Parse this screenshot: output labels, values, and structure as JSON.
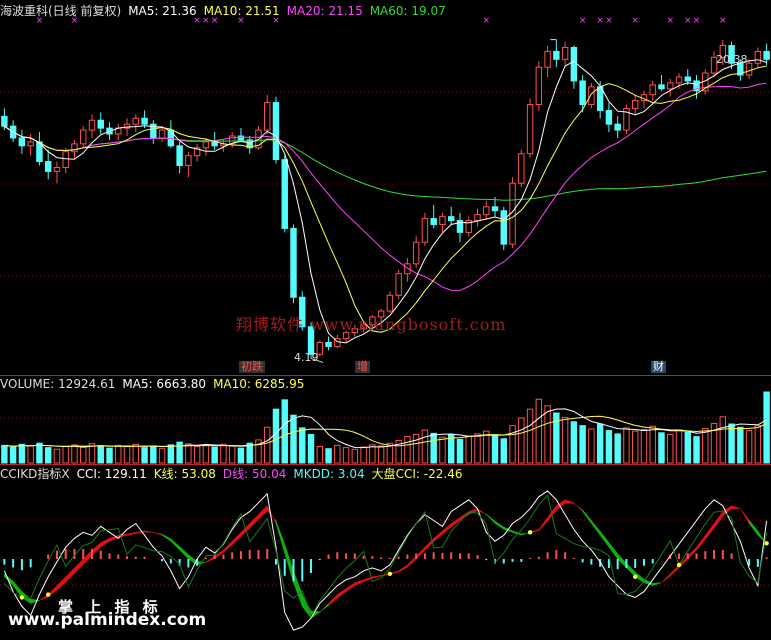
{
  "price_header": {
    "title": "海波重科(日线 前复权)",
    "ma5": "MA5: 21.36",
    "ma10": "MA10: 21.51",
    "ma20": "MA20: 21.15",
    "ma60": "MA60: 19.07"
  },
  "volume_header": {
    "title": "VOLUME: 12924.61",
    "ma5": "MA5: 6663.80",
    "ma10": "MA10: 6285.95"
  },
  "cci_header": {
    "title": "CCIKD指标X",
    "cci": "CCI: 129.11",
    "k": "K线: 53.08",
    "d": "D线: 50.04",
    "mkdd": "MKDD: 3.04",
    "dapan": "大盘CCI: -22.46"
  },
  "annotations": {
    "high_label": "20.38",
    "low_label": "4.19",
    "event_1": "初跌",
    "event_2": "增",
    "event_3": "财",
    "marker_glyph": "×"
  },
  "watermarks": {
    "top": "翔博软件 www.xiangbosoft.com",
    "bottom_cn": "掌 上 指 标",
    "bottom_url": "www.palmindex.com"
  },
  "colors": {
    "up": "#ff5050",
    "down": "#54fcfc",
    "ma5": "#ffffff",
    "ma10": "#ffff55",
    "ma20": "#ff44ff",
    "ma60": "#33dd33",
    "grid": "#8a1010"
  },
  "chart_data": [
    {
      "type": "candlestick",
      "title": "海波重科(日线 前复权)",
      "ylim": [
        3.5,
        21.5
      ],
      "labels": {
        "high": "20.38",
        "low": "4.19"
      },
      "series": [
        {
          "name": "MA5",
          "last": 21.36
        },
        {
          "name": "MA10",
          "last": 21.51
        },
        {
          "name": "MA20",
          "last": 21.15
        },
        {
          "name": "MA60",
          "last": 19.07
        }
      ],
      "ohlc": [
        [
          16.5,
          16.9,
          15.8,
          16.0
        ],
        [
          16.0,
          16.3,
          15.2,
          15.4
        ],
        [
          15.4,
          15.8,
          14.6,
          15.0
        ],
        [
          15.0,
          15.6,
          14.5,
          15.2
        ],
        [
          15.2,
          15.7,
          14.0,
          14.2
        ],
        [
          14.2,
          14.8,
          13.3,
          13.7
        ],
        [
          13.7,
          14.2,
          13.1,
          13.9
        ],
        [
          13.9,
          14.9,
          13.6,
          14.7
        ],
        [
          14.7,
          15.3,
          14.3,
          15.1
        ],
        [
          15.1,
          16.0,
          14.9,
          15.8
        ],
        [
          15.8,
          16.6,
          15.4,
          16.3
        ],
        [
          16.3,
          16.7,
          15.6,
          15.9
        ],
        [
          15.9,
          16.2,
          15.3,
          15.6
        ],
        [
          15.6,
          16.1,
          15.3,
          15.9
        ],
        [
          15.9,
          16.4,
          15.5,
          16.1
        ],
        [
          16.1,
          16.6,
          15.7,
          16.4
        ],
        [
          16.4,
          16.8,
          15.9,
          16.1
        ],
        [
          16.1,
          16.3,
          15.1,
          15.4
        ],
        [
          15.4,
          16.0,
          15.2,
          15.8
        ],
        [
          15.8,
          16.3,
          14.9,
          15.0
        ],
        [
          15.0,
          15.2,
          13.6,
          14.0
        ],
        [
          14.0,
          14.7,
          13.4,
          14.5
        ],
        [
          14.5,
          15.1,
          14.2,
          14.9
        ],
        [
          14.9,
          15.4,
          14.5,
          15.2
        ],
        [
          15.2,
          15.7,
          14.8,
          15.0
        ],
        [
          15.0,
          15.3,
          14.7,
          15.1
        ],
        [
          15.1,
          15.7,
          14.9,
          15.5
        ],
        [
          15.5,
          15.9,
          15.2,
          15.3
        ],
        [
          15.3,
          15.5,
          14.6,
          14.9
        ],
        [
          14.9,
          16.0,
          14.8,
          15.8
        ],
        [
          15.8,
          17.6,
          15.6,
          17.2
        ],
        [
          17.2,
          17.5,
          14.1,
          14.3
        ],
        [
          14.3,
          14.5,
          10.6,
          10.8
        ],
        [
          10.8,
          11.0,
          7.0,
          7.3
        ],
        [
          7.3,
          7.6,
          5.6,
          5.8
        ],
        [
          5.8,
          6.0,
          4.19,
          4.4
        ],
        [
          4.4,
          5.1,
          4.3,
          5.0
        ],
        [
          5.0,
          5.3,
          4.6,
          4.8
        ],
        [
          4.8,
          5.4,
          4.7,
          5.2
        ],
        [
          5.2,
          5.6,
          5.0,
          5.5
        ],
        [
          5.5,
          5.9,
          5.3,
          5.7
        ],
        [
          5.7,
          6.1,
          5.5,
          5.9
        ],
        [
          5.9,
          6.4,
          5.8,
          6.3
        ],
        [
          6.3,
          6.7,
          6.0,
          6.6
        ],
        [
          6.6,
          7.6,
          6.5,
          7.4
        ],
        [
          7.4,
          8.7,
          7.2,
          8.5
        ],
        [
          8.5,
          9.3,
          8.1,
          9.0
        ],
        [
          9.0,
          10.4,
          8.8,
          10.1
        ],
        [
          10.1,
          11.6,
          9.9,
          11.3
        ],
        [
          11.3,
          12.0,
          10.8,
          11.0
        ],
        [
          11.0,
          11.6,
          10.6,
          11.4
        ],
        [
          11.4,
          11.9,
          11.0,
          11.2
        ],
        [
          11.2,
          11.6,
          10.1,
          10.6
        ],
        [
          10.6,
          11.4,
          10.4,
          11.2
        ],
        [
          11.2,
          11.8,
          10.9,
          11.5
        ],
        [
          11.5,
          12.2,
          11.3,
          11.9
        ],
        [
          11.9,
          12.4,
          11.4,
          11.7
        ],
        [
          11.7,
          11.9,
          9.7,
          10.0
        ],
        [
          10.0,
          13.4,
          9.8,
          13.1
        ],
        [
          13.1,
          14.8,
          12.9,
          14.6
        ],
        [
          14.6,
          17.4,
          14.4,
          17.1
        ],
        [
          17.1,
          19.3,
          16.8,
          19.0
        ],
        [
          19.0,
          20.1,
          18.5,
          19.8
        ],
        [
          19.8,
          20.4,
          19.0,
          19.4
        ],
        [
          19.4,
          20.3,
          19.1,
          20.0
        ],
        [
          20.0,
          20.1,
          17.9,
          18.3
        ],
        [
          18.3,
          18.6,
          16.7,
          17.1
        ],
        [
          17.1,
          18.2,
          16.9,
          18.0
        ],
        [
          18.0,
          18.3,
          16.4,
          16.8
        ],
        [
          16.8,
          17.2,
          15.7,
          16.1
        ],
        [
          16.1,
          16.5,
          15.4,
          15.8
        ],
        [
          15.8,
          17.1,
          15.6,
          16.9
        ],
        [
          16.9,
          17.6,
          16.6,
          17.3
        ],
        [
          17.3,
          17.8,
          16.9,
          17.6
        ],
        [
          17.6,
          18.3,
          17.3,
          18.1
        ],
        [
          18.1,
          18.6,
          17.8,
          17.9
        ],
        [
          17.9,
          18.4,
          17.5,
          18.2
        ],
        [
          18.2,
          18.7,
          17.9,
          18.5
        ],
        [
          18.5,
          18.9,
          18.1,
          18.3
        ],
        [
          18.3,
          18.6,
          17.4,
          17.8
        ],
        [
          17.8,
          18.9,
          17.6,
          18.7
        ],
        [
          18.7,
          19.8,
          18.5,
          19.5
        ],
        [
          19.5,
          20.38,
          19.1,
          20.1
        ],
        [
          20.1,
          20.3,
          18.9,
          19.2
        ],
        [
          19.2,
          19.4,
          18.3,
          18.6
        ],
        [
          18.6,
          19.4,
          18.4,
          19.2
        ],
        [
          19.2,
          20.0,
          19.0,
          19.8
        ],
        [
          19.8,
          20.2,
          19.1,
          19.4
        ]
      ],
      "volume": {
        "last": 12924.61,
        "ma5_last": 6663.8,
        "ma10_last": 6285.95,
        "values": [
          3200,
          2900,
          3400,
          3100,
          3600,
          2800,
          2500,
          3000,
          3300,
          2900,
          3500,
          3100,
          2700,
          3200,
          3000,
          3400,
          2800,
          3100,
          2600,
          3300,
          3800,
          3500,
          3000,
          3200,
          2900,
          3400,
          3100,
          2700,
          3600,
          4200,
          6500,
          9800,
          11500,
          8700,
          6400,
          5200,
          3000,
          2600,
          3200,
          2800,
          2500,
          2900,
          3300,
          3100,
          3600,
          4100,
          4800,
          5200,
          6000,
          5400,
          4700,
          5100,
          4300,
          4900,
          5300,
          5800,
          5000,
          4400,
          6800,
          8200,
          9800,
          11600,
          10400,
          9100,
          8300,
          7500,
          6800,
          6200,
          7100,
          5900,
          5300,
          6400,
          5800,
          6100,
          6700,
          5500,
          5200,
          6000,
          5600,
          4800,
          6300,
          7200,
          8400,
          7100,
          6500,
          5900,
          6800,
          12924.61
        ]
      },
      "indicator": {
        "name": "CCIKD指标X",
        "cci": 129.11,
        "k": 53.08,
        "d": 50.04,
        "mkdd": 3.04,
        "dapan_cci": -22.46,
        "k_values": [
          -60,
          -90,
          -130,
          -150,
          -140,
          -120,
          -90,
          -60,
          -30,
          0,
          30,
          55,
          70,
          80,
          85,
          90,
          95,
          90,
          80,
          60,
          30,
          0,
          -20,
          -10,
          10,
          30,
          60,
          90,
          120,
          150,
          180,
          120,
          20,
          -80,
          -160,
          -200,
          -180,
          -150,
          -120,
          -100,
          -80,
          -70,
          -60,
          -55,
          -50,
          -40,
          -20,
          10,
          40,
          70,
          95,
          120,
          140,
          160,
          170,
          150,
          120,
          100,
          90,
          80,
          90,
          100,
          140,
          180,
          200,
          190,
          160,
          120,
          80,
          40,
          0,
          -30,
          -60,
          -80,
          -90,
          -80,
          -50,
          -20,
          10,
          40,
          80,
          120,
          160,
          180,
          170,
          120,
          80,
          53.08
        ],
        "d_values": [
          -50,
          -75,
          -110,
          -135,
          -140,
          -128,
          -105,
          -78,
          -48,
          -18,
          12,
          40,
          60,
          72,
          80,
          86,
          91,
          90,
          84,
          68,
          42,
          15,
          -8,
          -12,
          2,
          22,
          48,
          76,
          104,
          134,
          162,
          130,
          50,
          -40,
          -120,
          -175,
          -178,
          -158,
          -132,
          -110,
          -90,
          -76,
          -65,
          -58,
          -52,
          -44,
          -28,
          0,
          30,
          58,
          84,
          108,
          130,
          150,
          163,
          152,
          128,
          108,
          95,
          85,
          88,
          96,
          128,
          164,
          188,
          188,
          166,
          130,
          94,
          56,
          18,
          -14,
          -44,
          -68,
          -82,
          -80,
          -58,
          -30,
          0,
          30,
          66,
          104,
          144,
          170,
          170,
          132,
          94,
          50.04
        ],
        "cci_values": [
          -40,
          -110,
          -160,
          -190,
          -120,
          -60,
          -10,
          40,
          70,
          90,
          80,
          110,
          90,
          70,
          100,
          120,
          80,
          40,
          10,
          -40,
          -100,
          -60,
          0,
          40,
          20,
          50,
          100,
          140,
          160,
          190,
          220,
          40,
          -180,
          -240,
          -230,
          -200,
          -150,
          -120,
          -90,
          -70,
          -60,
          -40,
          -30,
          -40,
          -20,
          30,
          80,
          120,
          150,
          130,
          110,
          160,
          180,
          200,
          170,
          90,
          60,
          80,
          120,
          140,
          170,
          210,
          230,
          200,
          150,
          100,
          60,
          30,
          -10,
          -60,
          -90,
          -120,
          -130,
          -110,
          -70,
          -30,
          10,
          50,
          90,
          130,
          170,
          200,
          180,
          120,
          60,
          -30,
          -90,
          129.11
        ]
      }
    }
  ]
}
